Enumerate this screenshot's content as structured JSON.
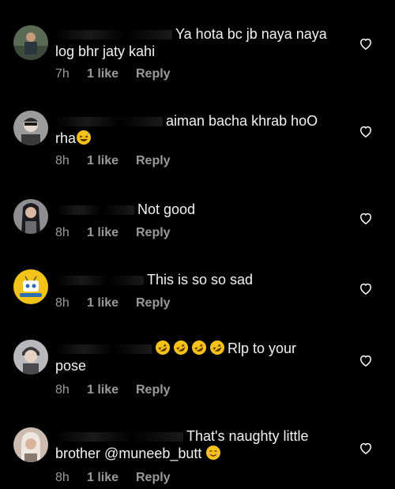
{
  "comments": [
    {
      "text_line1": "Ya hota bc jb naya naya",
      "text_line2": "log bhr jaty kahi",
      "time": "7h",
      "likes": "1 like",
      "reply": "Reply"
    },
    {
      "text_line1": "aiman bacha khrab hoO",
      "text_line2": "rha",
      "time": "8h",
      "likes": "1 like",
      "reply": "Reply",
      "emoji": "grinning-squint-sweat-emoji"
    },
    {
      "text_line1": "Not good",
      "time": "8h",
      "likes": "1 like",
      "reply": "Reply"
    },
    {
      "text_line1": "This is so so sad",
      "time": "8h",
      "likes": "1 like",
      "reply": "Reply"
    },
    {
      "text_line1": "Rlp to your",
      "text_line2": "pose",
      "time": "8h",
      "likes": "1 like",
      "reply": "Reply",
      "emoji": "rolling-on-floor-laughing-emoji"
    },
    {
      "text_line1": "That's naughty little",
      "text_line2": "brother @muneeb_butt",
      "time": "8h",
      "likes": "1 like",
      "reply": "Reply",
      "emoji": "smiling-face-emoji"
    }
  ],
  "colors": {
    "background": "#000000",
    "text": "#f2f2f2",
    "muted": "#9a9a9a",
    "heart_outline": "#ffffff",
    "emoji_yellow": "#f7c21a"
  }
}
